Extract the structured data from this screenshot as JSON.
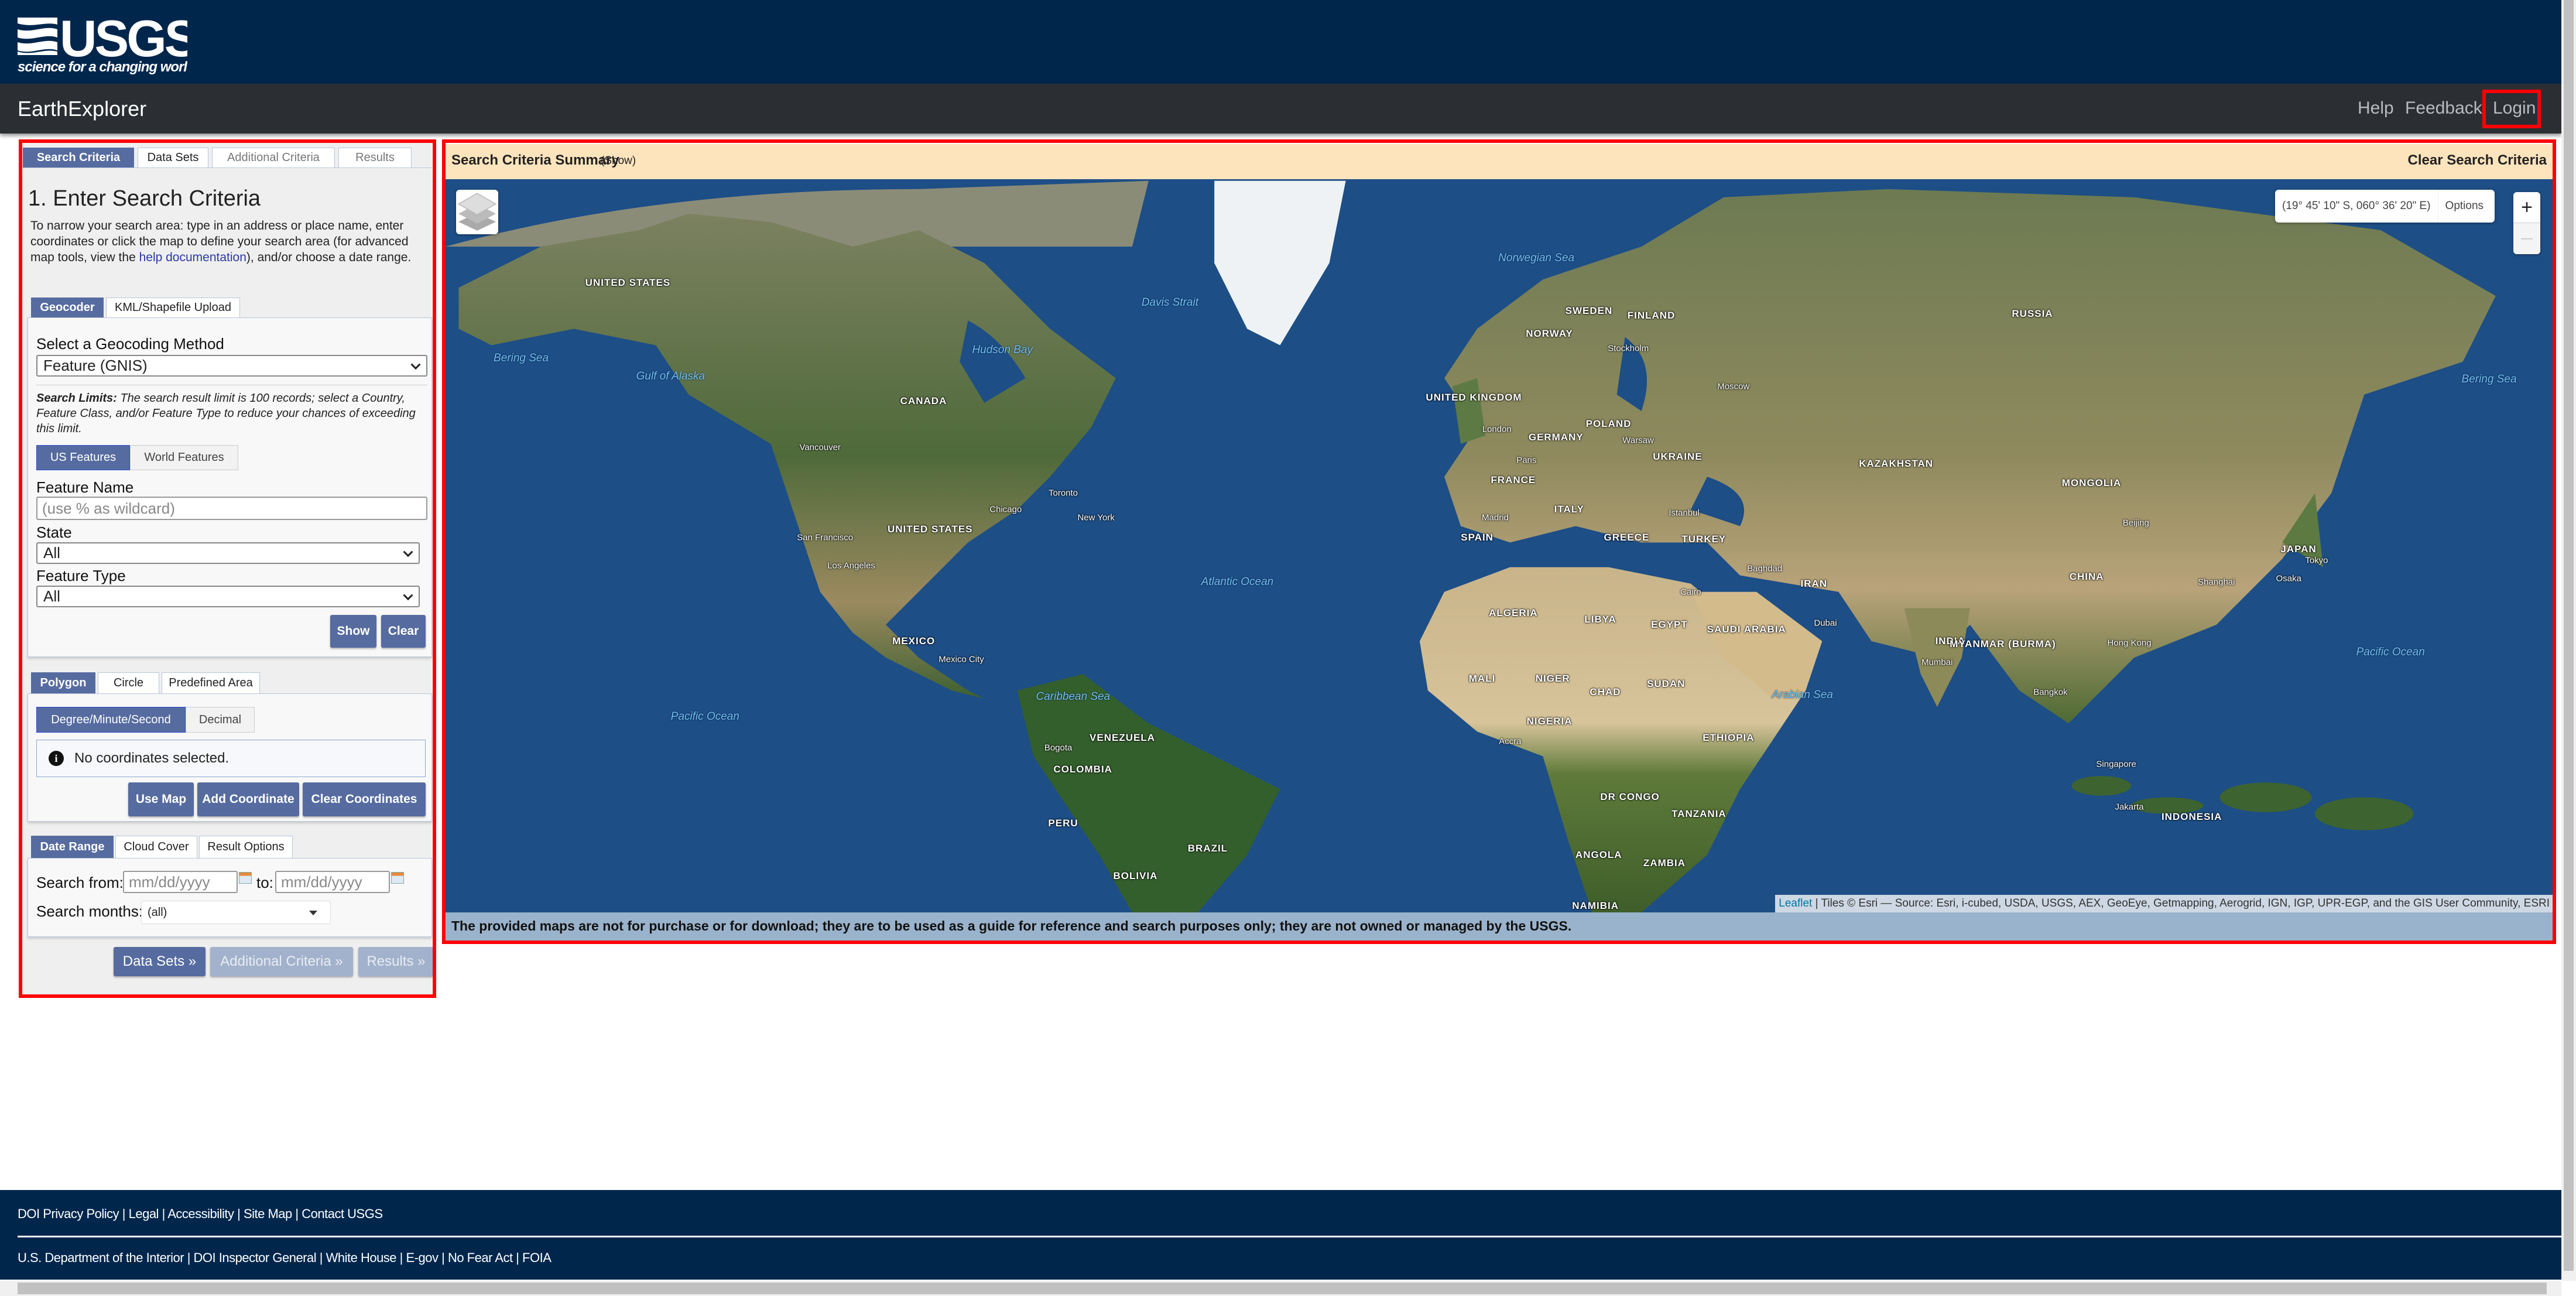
{
  "header": {
    "logo_text": "USGS",
    "logo_tagline": "science for a changing world",
    "app_title": "EarthExplorer",
    "nav": [
      "Help",
      "Feedback",
      "Login"
    ]
  },
  "left_panel": {
    "tabs": [
      "Search Criteria",
      "Data Sets",
      "Additional Criteria",
      "Results"
    ],
    "heading": "1. Enter Search Criteria",
    "intro_before": "To narrow your search area: type in an address or place name, enter coordinates or click the map to define your search area (for advanced map tools, view the ",
    "intro_link": "help documentation",
    "intro_after": "), and/or choose a date range.",
    "area_tabs": [
      "Geocoder",
      "KML/Shapefile Upload"
    ],
    "geocoding_label": "Select a Geocoding Method",
    "geocoding_value": "Feature (GNIS)",
    "limits_bold": "Search Limits:",
    "limits_text": " The search result limit is 100 records; select a Country, Feature Class, and/or Feature Type to reduce your chances of exceeding this limit.",
    "feature_toggle": [
      "US Features",
      "World Features"
    ],
    "feature_name_label": "Feature Name",
    "feature_name_placeholder": "(use % as wildcard)",
    "state_label": "State",
    "state_value": "All",
    "feature_type_label": "Feature Type",
    "feature_type_value": "All",
    "show_button": "Show",
    "clear_button": "Clear",
    "shape_tabs": [
      "Polygon",
      "Circle",
      "Predefined Area"
    ],
    "coord_format": [
      "Degree/Minute/Second",
      "Decimal"
    ],
    "no_coords": "No coordinates selected.",
    "coord_buttons": [
      "Use Map",
      "Add Coordinate",
      "Clear Coordinates"
    ],
    "date_tabs": [
      "Date Range",
      "Cloud Cover",
      "Result Options"
    ],
    "search_from_label": "Search from:",
    "date_placeholder": "mm/dd/yyyy",
    "to_label": "to:",
    "search_months_label": "Search months:",
    "search_months_value": "(all)",
    "nav_buttons": [
      "Data Sets »",
      "Additional Criteria »",
      "Results »"
    ]
  },
  "map_panel": {
    "summary_title": "Search Criteria Summary",
    "summary_show": "(Show)",
    "clear_link": "Clear Search Criteria",
    "coordinates": "(19° 45' 10\" S, 060° 36' 20\" E)",
    "options": "Options",
    "zoom_in": "+",
    "zoom_out": "—",
    "attribution_link": "Leaflet",
    "attribution_text": " | Tiles © Esri — Source: Esri, i-cubed, USDA, USGS, AEX, GeoEye, Getmapping, Aerogrid, IGN, IGP, UPR-EGP, and the GIS User Community, ESRI",
    "disclaimer": "The provided maps are not for purchase or for download; they are to be used as a guide for reference and search purposes only; they are not owned or managed by the USGS.",
    "icons": {
      "layers": "layers-icon"
    },
    "labels": [
      {
        "text": "UNITED STATES",
        "kind": "country"
      },
      {
        "text": "CANADA",
        "kind": "country"
      },
      {
        "text": "UNITED STATES",
        "kind": "country"
      },
      {
        "text": "MEXICO",
        "kind": "country"
      },
      {
        "text": "VENEZUELA",
        "kind": "country"
      },
      {
        "text": "COLOMBIA",
        "kind": "country"
      },
      {
        "text": "PERU",
        "kind": "country"
      },
      {
        "text": "BRAZIL",
        "kind": "country"
      },
      {
        "text": "BOLIVIA",
        "kind": "country"
      },
      {
        "text": "SWEDEN",
        "kind": "country"
      },
      {
        "text": "FINLAND",
        "kind": "country"
      },
      {
        "text": "NORWAY",
        "kind": "country"
      },
      {
        "text": "RUSSIA",
        "kind": "country"
      },
      {
        "text": "UNITED KINGDOM",
        "kind": "country"
      },
      {
        "text": "POLAND",
        "kind": "country"
      },
      {
        "text": "GERMANY",
        "kind": "country"
      },
      {
        "text": "UKRAINE",
        "kind": "country"
      },
      {
        "text": "FRANCE",
        "kind": "country"
      },
      {
        "text": "KAZAKHSTAN",
        "kind": "country"
      },
      {
        "text": "MONGOLIA",
        "kind": "country"
      },
      {
        "text": "SPAIN",
        "kind": "country"
      },
      {
        "text": "ITALY",
        "kind": "country"
      },
      {
        "text": "GREECE",
        "kind": "country"
      },
      {
        "text": "TURKEY",
        "kind": "country"
      },
      {
        "text": "IRAN",
        "kind": "country"
      },
      {
        "text": "CHINA",
        "kind": "country"
      },
      {
        "text": "JAPAN",
        "kind": "country"
      },
      {
        "text": "ALGERIA",
        "kind": "country"
      },
      {
        "text": "LIBYA",
        "kind": "country"
      },
      {
        "text": "EGYPT",
        "kind": "country"
      },
      {
        "text": "SAUDI ARABIA",
        "kind": "country"
      },
      {
        "text": "INDIA",
        "kind": "country"
      },
      {
        "text": "MYANMAR (BURMA)",
        "kind": "country"
      },
      {
        "text": "MALI",
        "kind": "country"
      },
      {
        "text": "NIGER",
        "kind": "country"
      },
      {
        "text": "CHAD",
        "kind": "country"
      },
      {
        "text": "SUDAN",
        "kind": "country"
      },
      {
        "text": "NIGERIA",
        "kind": "country"
      },
      {
        "text": "ETHIOPIA",
        "kind": "country"
      },
      {
        "text": "DR CONGO",
        "kind": "country"
      },
      {
        "text": "TANZANIA",
        "kind": "country"
      },
      {
        "text": "ANGOLA",
        "kind": "country"
      },
      {
        "text": "ZAMBIA",
        "kind": "country"
      },
      {
        "text": "NAMIBIA",
        "kind": "country"
      },
      {
        "text": "INDONESIA",
        "kind": "country"
      },
      {
        "text": "Atlantic Ocean",
        "kind": "ocean"
      },
      {
        "text": "Pacific Ocean",
        "kind": "ocean"
      },
      {
        "text": "Pacific Ocean",
        "kind": "ocean"
      },
      {
        "text": "Arabian Sea",
        "kind": "ocean"
      },
      {
        "text": "Caribbean Sea",
        "kind": "ocean"
      },
      {
        "text": "Norwegian Sea",
        "kind": "ocean"
      },
      {
        "text": "Bering Sea",
        "kind": "ocean"
      },
      {
        "text": "Bering Sea",
        "kind": "ocean"
      },
      {
        "text": "Hudson Bay",
        "kind": "ocean"
      },
      {
        "text": "Davis Strait",
        "kind": "ocean"
      },
      {
        "text": "Gulf of Alaska",
        "kind": "ocean"
      },
      {
        "text": "Vancouver",
        "kind": "city"
      },
      {
        "text": "Chicago",
        "kind": "city"
      },
      {
        "text": "Toronto",
        "kind": "city"
      },
      {
        "text": "New York",
        "kind": "city"
      },
      {
        "text": "San Francisco",
        "kind": "city"
      },
      {
        "text": "Los Angeles",
        "kind": "city"
      },
      {
        "text": "Mexico City",
        "kind": "city"
      },
      {
        "text": "Bogota",
        "kind": "city"
      },
      {
        "text": "London",
        "kind": "city"
      },
      {
        "text": "Paris",
        "kind": "city"
      },
      {
        "text": "Madrid",
        "kind": "city"
      },
      {
        "text": "Warsaw",
        "kind": "city"
      },
      {
        "text": "Stockholm",
        "kind": "city"
      },
      {
        "text": "Moscow",
        "kind": "city"
      },
      {
        "text": "Istanbul",
        "kind": "city"
      },
      {
        "text": "Cairo",
        "kind": "city"
      },
      {
        "text": "Baghdad",
        "kind": "city"
      },
      {
        "text": "Dubai",
        "kind": "city"
      },
      {
        "text": "Mumbai",
        "kind": "city"
      },
      {
        "text": "Hong Kong",
        "kind": "city"
      },
      {
        "text": "Bangkok",
        "kind": "city"
      },
      {
        "text": "Shanghai",
        "kind": "city"
      },
      {
        "text": "Beijing",
        "kind": "city"
      },
      {
        "text": "Tokyo",
        "kind": "city"
      },
      {
        "text": "Osaka",
        "kind": "city"
      },
      {
        "text": "Singapore",
        "kind": "city"
      },
      {
        "text": "Jakarta",
        "kind": "city"
      },
      {
        "text": "Accra",
        "kind": "city"
      }
    ]
  },
  "footer": {
    "row1": [
      "DOI Privacy Policy",
      "Legal",
      "Accessibility",
      "Site Map",
      "Contact USGS"
    ],
    "row2": [
      "U.S. Department of the Interior",
      "DOI Inspector General",
      "White House",
      "E-gov",
      "No Fear Act",
      "FOIA"
    ]
  },
  "colors": {
    "header": "#00264c",
    "accent": "#566b9f",
    "highlight": "#ff0000",
    "summary_bar": "#fde4bd"
  }
}
